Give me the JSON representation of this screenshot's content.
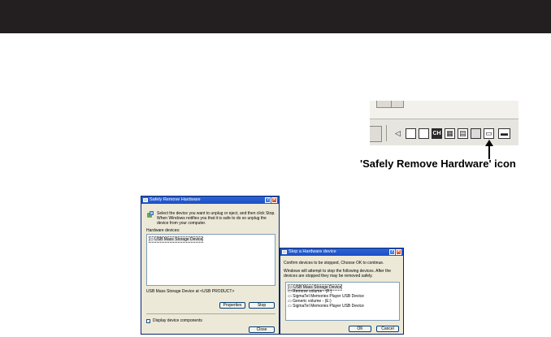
{
  "taskbar": {
    "tray_icons": [
      "speaker-icon",
      "network-icon",
      "window-icon",
      "language-indicator-icon",
      "keyboard-icon",
      "printer-icon",
      "safely-remove-hardware-icon",
      "display-icon"
    ],
    "language_indicator": "CH",
    "caption": "'Safely Remove Hardware' icon"
  },
  "safely_remove_dialog": {
    "title": "Safely Remove Hardware",
    "help_button": "?",
    "close_button": "✕",
    "instructions": "Select the device you want to unplug or eject, and then click Stop. When Windows notifies you that it is safe to do so unplug the device from your computer.",
    "hardware_label": "Hardware devices:",
    "devices": [
      "USB Mass Storage Device"
    ],
    "device_description": "USB Mass Storage Device at <USB PRODUCT>",
    "properties_button": "Properties",
    "stop_button": "Stop",
    "display_components_label": "Display device components",
    "close_label": "Close"
  },
  "stop_device_dialog": {
    "title": "Stop a Hardware device",
    "help_button": "?",
    "close_button": "✕",
    "confirm_text": "Confirm devices to be stopped, Choose OK to continue.",
    "warning_text": "Windows will attempt to stop the following devices. After the devices are stopped they may be removed safely.",
    "devices": [
      "USB Mass Storage Device",
      "Remove volume - (F:)",
      "SigmaTel Memories Player USB Device",
      "Generic volume - (E:)",
      "SigmaTel Memories Player USB Device"
    ],
    "ok_button": "OK",
    "cancel_button": "Cancel"
  }
}
